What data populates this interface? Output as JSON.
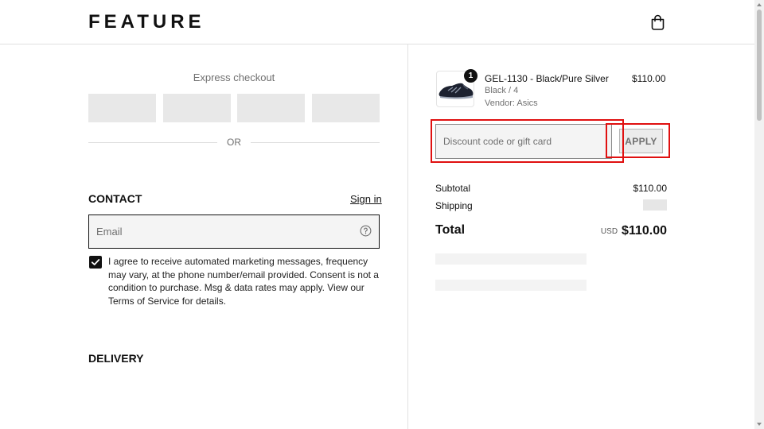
{
  "header": {
    "logo": "FEATURE",
    "cart_icon": "shopping-bag-icon"
  },
  "checkout": {
    "express_title": "Express checkout",
    "or_divider": "OR",
    "contact": {
      "heading": "CONTACT",
      "sign_in_label": "Sign in",
      "email_placeholder": "Email",
      "email_value": "",
      "help_icon": "question-circle-icon"
    },
    "consent": {
      "checked": true,
      "text": "I agree to receive automated marketing messages, frequency may vary, at the phone number/email provided. Consent is not a condition to purchase. Msg & data rates may apply. View our Terms of Service for details."
    },
    "delivery_heading": "DELIVERY"
  },
  "order_summary": {
    "item": {
      "quantity": "1",
      "name": "GEL-1130 - Black/Pure Silver",
      "variant": "Black / 4",
      "vendor": "Vendor: Asics",
      "price": "$110.00"
    },
    "discount": {
      "placeholder": "Discount code or gift card",
      "value": "",
      "apply_label": "APPLY"
    },
    "subtotal_label": "Subtotal",
    "subtotal_value": "$110.00",
    "shipping_label": "Shipping",
    "total_label": "Total",
    "total_currency": "USD",
    "total_value": "$110.00"
  },
  "colors": {
    "highlight": "#e01010",
    "text": "#111111",
    "muted": "#707070",
    "skeleton": "#e8e8e8"
  }
}
